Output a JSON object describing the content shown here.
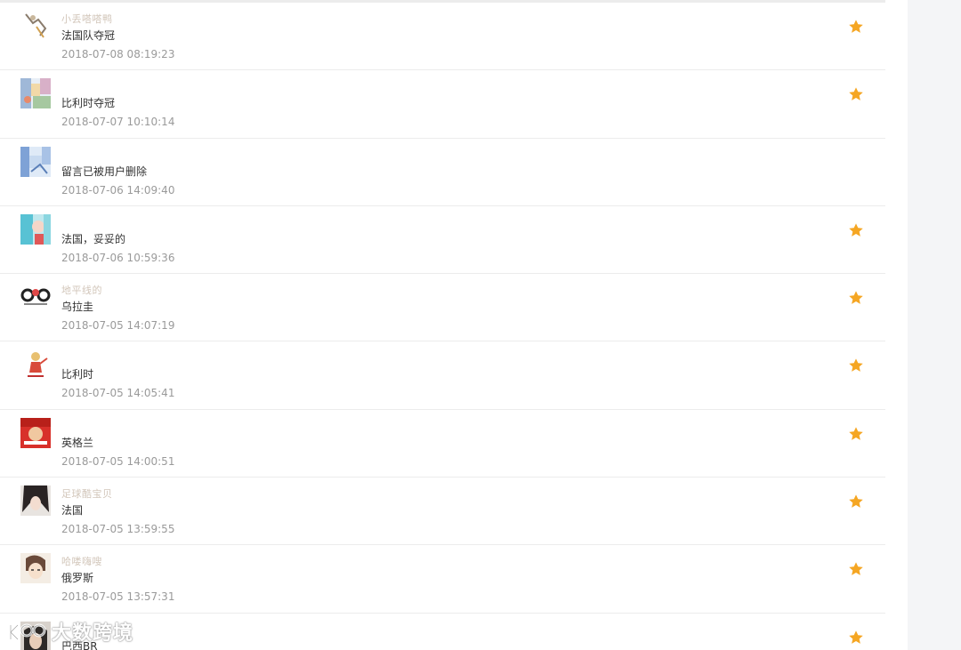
{
  "comments": [
    {
      "nickname": "小丢嗒嗒鸭",
      "content": "法国队夺冠",
      "time": "2018-07-08 08:19:23",
      "starred": true,
      "avatar": "figure-white"
    },
    {
      "nickname": "",
      "content": "比利时夺冠",
      "time": "2018-07-07 10:10:14",
      "starred": true,
      "avatar": "colorful-collage"
    },
    {
      "nickname": "",
      "content": "留言已被用户删除",
      "time": "2018-07-06 14:09:40",
      "starred": false,
      "avatar": "blue-sky"
    },
    {
      "nickname": "",
      "content": "法国，妥妥的",
      "time": "2018-07-06 10:59:36",
      "starred": true,
      "avatar": "cyan-red"
    },
    {
      "nickname": "地平线的",
      "content": "乌拉圭",
      "time": "2018-07-05 14:07:19",
      "starred": true,
      "avatar": "black-circles"
    },
    {
      "nickname": "",
      "content": "比利时",
      "time": "2018-07-05 14:05:41",
      "starred": true,
      "avatar": "red-figure"
    },
    {
      "nickname": "",
      "content": "英格兰",
      "time": "2018-07-05 14:00:51",
      "starred": true,
      "avatar": "red-poster"
    },
    {
      "nickname": "足球酷宝贝",
      "content": "法国",
      "time": "2018-07-05 13:59:55",
      "starred": true,
      "avatar": "dark-hair"
    },
    {
      "nickname": "哈喽嗨嗖",
      "content": "俄罗斯",
      "time": "2018-07-05 13:57:31",
      "starred": true,
      "avatar": "sketch-face"
    },
    {
      "nickname": "",
      "content": "巴西BR",
      "time": "",
      "starred": true,
      "avatar": "dark-portrait"
    }
  ],
  "watermark": {
    "text": "大数跨境"
  },
  "colors": {
    "star": "#f5a623",
    "divider": "#ececec",
    "time": "#9a9a9a",
    "content": "#333333"
  }
}
